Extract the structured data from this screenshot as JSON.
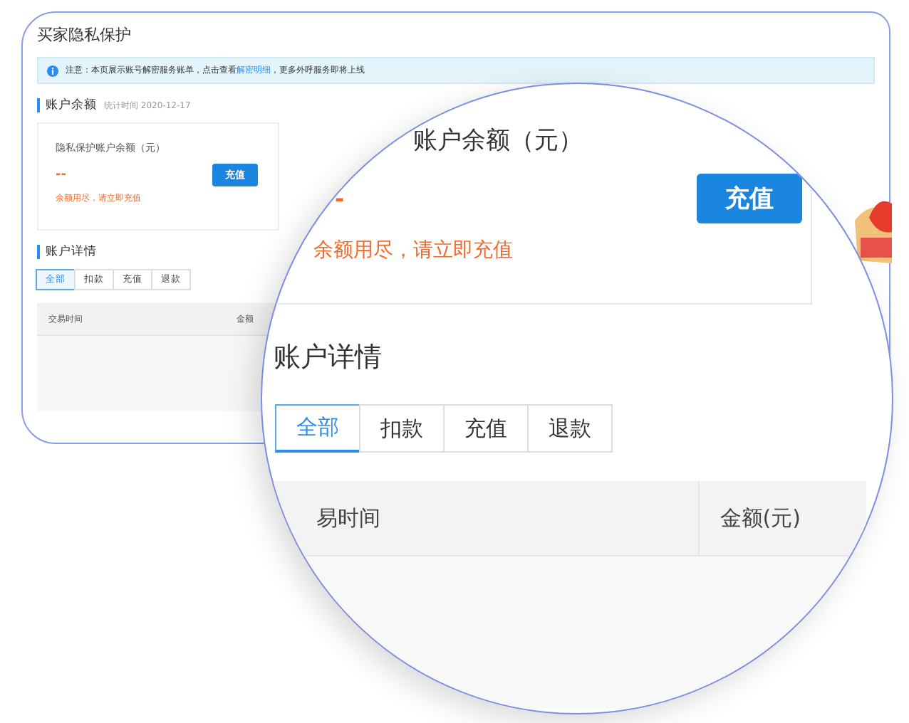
{
  "page": {
    "title": "买家隐私保护",
    "notice": {
      "before": "注意：本页展示账号解密服务账单，点击查看",
      "link": "解密明细",
      "after": "，更多外呼服务即将上线"
    },
    "balance_section": {
      "title": "账户余额",
      "stat_time": "统计时间 2020-12-17"
    },
    "balance_card": {
      "label": "隐私保护账户余额（元）",
      "value": "--",
      "button": "充值",
      "warning": "余额用尽，请立即充值"
    },
    "details_section": {
      "title": "账户详情"
    },
    "tabs": [
      {
        "label": "全部",
        "selected": true
      },
      {
        "label": "扣款",
        "selected": false
      },
      {
        "label": "充值",
        "selected": false
      },
      {
        "label": "退款",
        "selected": false
      }
    ],
    "table": {
      "columns": [
        "交易时间",
        "金额"
      ]
    }
  },
  "magnifier": {
    "balance_card": {
      "label": "账户余额（元）",
      "value": "-",
      "button": "充值",
      "warning": "余额用尽，请立即充值"
    },
    "details_title": "账户详情",
    "tabs": [
      {
        "label": "全部",
        "selected": true
      },
      {
        "label": "扣款",
        "selected": false
      },
      {
        "label": "充值",
        "selected": false
      },
      {
        "label": "退款",
        "selected": false
      }
    ],
    "table": {
      "columns": [
        "易时间",
        "金额(元)"
      ]
    }
  }
}
